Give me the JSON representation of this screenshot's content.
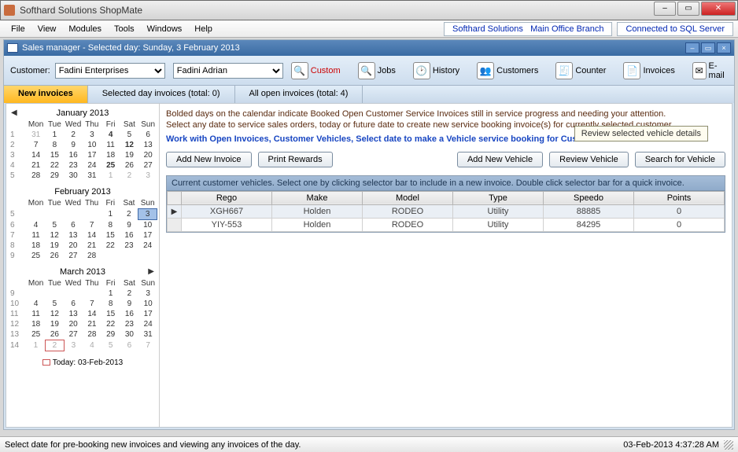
{
  "window": {
    "title": "Softhard Solutions ShopMate"
  },
  "menubar": {
    "items": [
      "File",
      "View",
      "Modules",
      "Tools",
      "Windows",
      "Help"
    ],
    "info_company": "Softhard Solutions",
    "info_branch": "Main Office Branch",
    "info_sql": "Connected to SQL Server"
  },
  "panel": {
    "title": "Sales manager - Selected day: Sunday, 3 February 2013"
  },
  "toolbar": {
    "customer_label": "Customer:",
    "customer_value": "Fadini Enterprises",
    "contact_value": "Fadini Adrian",
    "actions": {
      "custom": "Custom",
      "jobs": "Jobs",
      "history": "History",
      "customers": "Customers",
      "counter": "Counter",
      "invoices": "Invoices",
      "email": "E-mail"
    }
  },
  "tabs": {
    "new": "New invoices",
    "day": "Selected day invoices (total: 0)",
    "all": "All open invoices (total: 4)"
  },
  "calendar": {
    "dow": [
      "Mon",
      "Tue",
      "Wed",
      "Thu",
      "Fri",
      "Sat",
      "Sun"
    ],
    "today_label": "Today: 03-Feb-2013",
    "months": [
      {
        "title": "January 2013",
        "wk": [
          "1",
          "2",
          "3",
          "4",
          "5"
        ],
        "rows": [
          [
            "31",
            "1",
            "2",
            "3",
            "4",
            "5",
            "6"
          ],
          [
            "7",
            "8",
            "9",
            "10",
            "11",
            "12",
            "13"
          ],
          [
            "14",
            "15",
            "16",
            "17",
            "18",
            "19",
            "20"
          ],
          [
            "21",
            "22",
            "23",
            "24",
            "25",
            "26",
            "27"
          ],
          [
            "28",
            "29",
            "30",
            "31",
            "1",
            "2",
            "3"
          ]
        ],
        "dim": [
          [
            0
          ],
          [],
          [],
          [],
          [
            4,
            5,
            6
          ]
        ],
        "bold": [
          [
            "4"
          ],
          [
            "12"
          ],
          [],
          [
            "25"
          ],
          []
        ]
      },
      {
        "title": "February 2013",
        "wk": [
          "5",
          "6",
          "7",
          "8",
          "9"
        ],
        "rows": [
          [
            "",
            "",
            "",
            "",
            "1",
            "2",
            "3"
          ],
          [
            "4",
            "5",
            "6",
            "7",
            "8",
            "9",
            "10"
          ],
          [
            "11",
            "12",
            "13",
            "14",
            "15",
            "16",
            "17"
          ],
          [
            "18",
            "19",
            "20",
            "21",
            "22",
            "23",
            "24"
          ],
          [
            "25",
            "26",
            "27",
            "28",
            "",
            "",
            ""
          ]
        ],
        "selected": [
          0,
          6
        ]
      },
      {
        "title": "March 2013",
        "wk": [
          "9",
          "10",
          "11",
          "12",
          "13",
          "14"
        ],
        "rows": [
          [
            "",
            "",
            "",
            "",
            "1",
            "2",
            "3"
          ],
          [
            "4",
            "5",
            "6",
            "7",
            "8",
            "9",
            "10"
          ],
          [
            "11",
            "12",
            "13",
            "14",
            "15",
            "16",
            "17"
          ],
          [
            "18",
            "19",
            "20",
            "21",
            "22",
            "23",
            "24"
          ],
          [
            "25",
            "26",
            "27",
            "28",
            "29",
            "30",
            "31"
          ],
          [
            "1",
            "2",
            "3",
            "4",
            "5",
            "6",
            "7"
          ]
        ],
        "dim": [
          [],
          [],
          [],
          [],
          [],
          [
            0,
            1,
            2,
            3,
            4,
            5,
            6
          ]
        ],
        "today": [
          5,
          1
        ]
      }
    ]
  },
  "right": {
    "info1": "Bolded days on the calendar indicate Booked Open Customer Service Invoices still in service progress and needing your attention.",
    "info2": "Select any date to service sales orders, today or future date to create new service booking invoice(s) for currently selected customer.",
    "link": "Work with Open Invoices, Customer Vehicles, Select date to make a Vehicle service booking for Customer",
    "tooltip": "Review selected vehicle details",
    "buttons": {
      "add_invoice": "Add New Invoice",
      "print_rewards": "Print Rewards",
      "add_vehicle": "Add New Vehicle",
      "review_vehicle": "Review Vehicle",
      "search_vehicle": "Search for Vehicle"
    },
    "vehicle_header": "Current customer vehicles. Select one by clicking selector bar to include in a new invoice. Double click selector bar for a quick invoice.",
    "columns": [
      "Rego",
      "Make",
      "Model",
      "Type",
      "Speedo",
      "Points"
    ],
    "rows": [
      {
        "rego": "XGH667",
        "make": "Holden",
        "model": "RODEO",
        "type": "Utility",
        "speedo": "88885",
        "points": "0",
        "selected": true
      },
      {
        "rego": "YIY-553",
        "make": "Holden",
        "model": "RODEO",
        "type": "Utility",
        "speedo": "84295",
        "points": "0"
      }
    ]
  },
  "statusbar": {
    "left": "Select date for pre-booking new invoices and viewing any invoices of the day.",
    "right": "03-Feb-2013  4:37:28 AM"
  }
}
